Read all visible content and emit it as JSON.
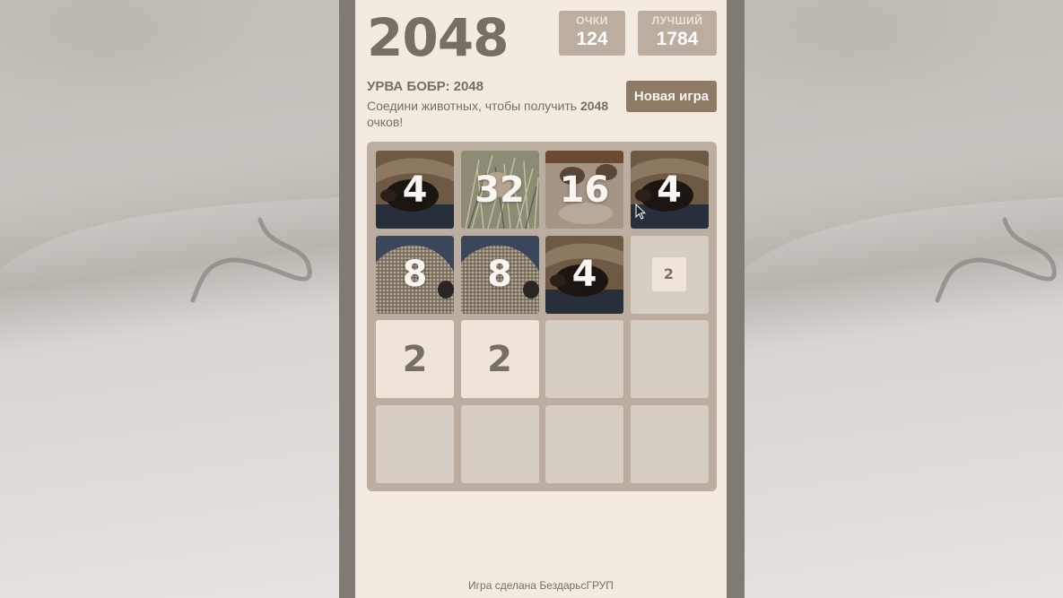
{
  "header": {
    "title": "2048",
    "score_label": "ОЧКИ",
    "score_value": "124",
    "best_label": "ЛУЧШИЙ",
    "best_value": "1784"
  },
  "intro": {
    "subtitle": "УРВА БОБР: 2048",
    "text_before": "Соедини животных, чтобы получить ",
    "text_bold": "2048",
    "text_after": " очков!"
  },
  "new_game_label": "Новая игра",
  "board": {
    "size": 4,
    "tiles": [
      {
        "row": 0,
        "col": 0,
        "value": "4",
        "image": "beaver"
      },
      {
        "row": 0,
        "col": 1,
        "value": "32",
        "image": "grass"
      },
      {
        "row": 0,
        "col": 2,
        "value": "16",
        "image": "burrow"
      },
      {
        "row": 0,
        "col": 3,
        "value": "4",
        "image": "beaver"
      },
      {
        "row": 1,
        "col": 0,
        "value": "8",
        "image": "hedgehog"
      },
      {
        "row": 1,
        "col": 1,
        "value": "8",
        "image": "hedgehog"
      },
      {
        "row": 1,
        "col": 2,
        "value": "4",
        "image": "beaver"
      },
      {
        "row": 1,
        "col": 3,
        "value": "2",
        "image": "new-small"
      },
      {
        "row": 2,
        "col": 0,
        "value": "2",
        "image": "none"
      },
      {
        "row": 2,
        "col": 1,
        "value": "2",
        "image": "none"
      }
    ]
  },
  "footer": "Игра сделана БездарьсГРУП",
  "colors": {
    "board": "#bbada0",
    "empty_cell": "#d6cdc4",
    "tile_2": "#eee4da",
    "text": "#776e65",
    "button": "#8f7a66",
    "page": "#f3ebe2"
  }
}
